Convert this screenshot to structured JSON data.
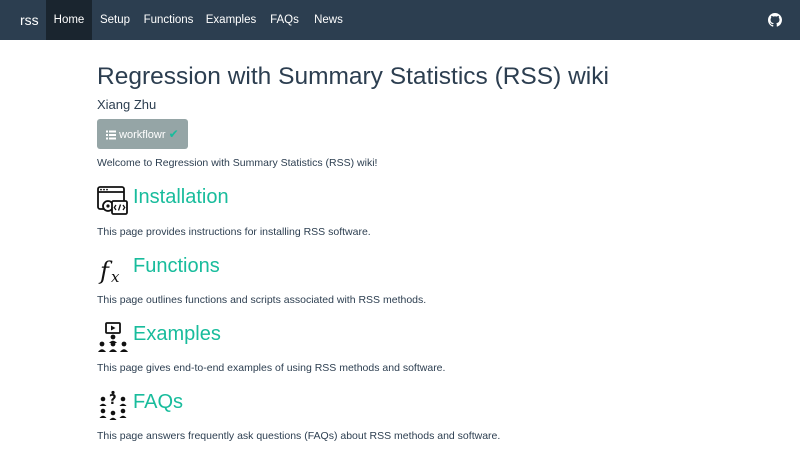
{
  "navbar": {
    "brand": "rss",
    "items": [
      {
        "label": "Home",
        "active": true
      },
      {
        "label": "Setup",
        "active": false
      },
      {
        "label": "Functions",
        "active": false
      },
      {
        "label": "Examples",
        "active": false
      },
      {
        "label": "FAQs",
        "active": false
      },
      {
        "label": "News",
        "active": false
      }
    ],
    "github_icon": "github-icon"
  },
  "page": {
    "title": "Regression with Summary Statistics (RSS) wiki",
    "author": "Xiang Zhu",
    "workflowr_label": "workflowr",
    "welcome": "Welcome to Regression with Summary Statistics (RSS) wiki!"
  },
  "sections": [
    {
      "heading": "Installation",
      "description": "This page provides instructions for installing RSS software.",
      "icon": "code-window-icon"
    },
    {
      "heading": "Functions",
      "description": "This page outlines functions and scripts associated with RSS methods.",
      "icon": "function-icon"
    },
    {
      "heading": "Examples",
      "description": "This page gives end-to-end examples of using RSS methods and software.",
      "icon": "presentation-icon"
    },
    {
      "heading": "FAQs",
      "description": "This page answers frequently ask questions (FAQs) about RSS methods and software.",
      "icon": "question-people-icon"
    }
  ],
  "colors": {
    "navbar_bg": "#2c3e50",
    "navbar_active": "#1a252f",
    "accent": "#18bc9c",
    "button_bg": "#95a5a6",
    "text": "#2c3e50"
  }
}
